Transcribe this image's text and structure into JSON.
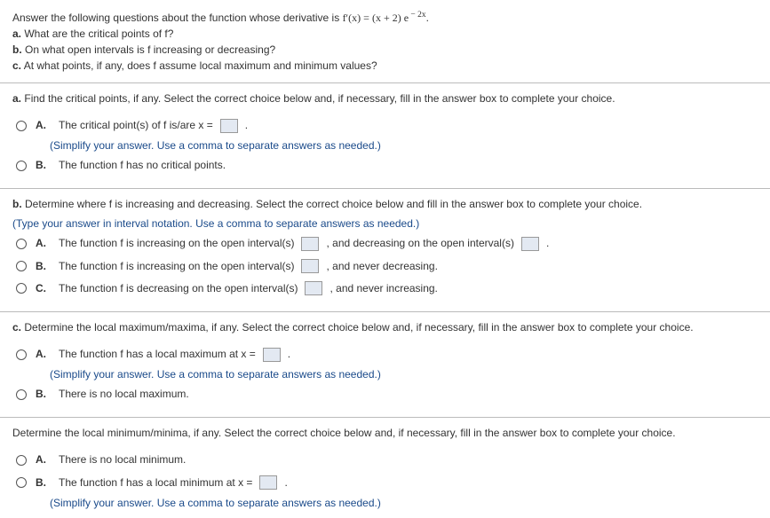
{
  "intro": {
    "line1_pre": "Answer the following questions about the function whose derivative is ",
    "line1_math": "f′(x) = (x + 2) e",
    "line1_exp": " − 2x",
    "line1_post": ".",
    "a": "What are the critical points of f?",
    "b": "On what open intervals is f increasing or decreasing?",
    "c": "At what points, if any, does f assume local maximum and minimum values?"
  },
  "partA": {
    "prompt": "Find the critical points, if any. Select the correct choice below and, if necessary, fill in the answer box to complete your choice.",
    "optA_pre": "The critical point(s) of f is/are x =",
    "optA_post": ".",
    "optA_sub": "(Simplify your answer. Use a comma to separate answers as needed.)",
    "optB": "The function f has no critical points."
  },
  "partB": {
    "prompt": "Determine where f is increasing and decreasing. Select the correct choice below and fill in the answer box to complete your choice.",
    "sub": "(Type your answer in interval notation. Use a comma to separate answers as needed.)",
    "optA_pre": "The function f is increasing on the open interval(s)",
    "optA_mid": ", and decreasing on the open interval(s)",
    "optA_post": ".",
    "optB_pre": "The function f is increasing on the open interval(s)",
    "optB_post": ", and never decreasing.",
    "optC_pre": "The function f is decreasing on the open interval(s)",
    "optC_post": ", and never increasing."
  },
  "partC": {
    "prompt": "Determine the local maximum/maxima, if any. Select the correct choice below and, if necessary, fill in the answer box to complete your choice.",
    "optA_pre": "The function f has a local maximum at x =",
    "optA_post": ".",
    "optA_sub": "(Simplify your answer. Use a comma to separate answers as needed.)",
    "optB": "There is no local maximum."
  },
  "partD": {
    "prompt": "Determine the local minimum/minima, if any. Select the correct choice below and, if necessary, fill in the answer box to complete your choice.",
    "optA": "There is no local minimum.",
    "optB_pre": "The function f has a local minimum at x =",
    "optB_post": ".",
    "optB_sub": "(Simplify your answer. Use a comma to separate answers as needed.)"
  },
  "labels": {
    "a": "a.",
    "b": "b.",
    "c": "c.",
    "A": "A.",
    "B": "B.",
    "C": "C."
  }
}
